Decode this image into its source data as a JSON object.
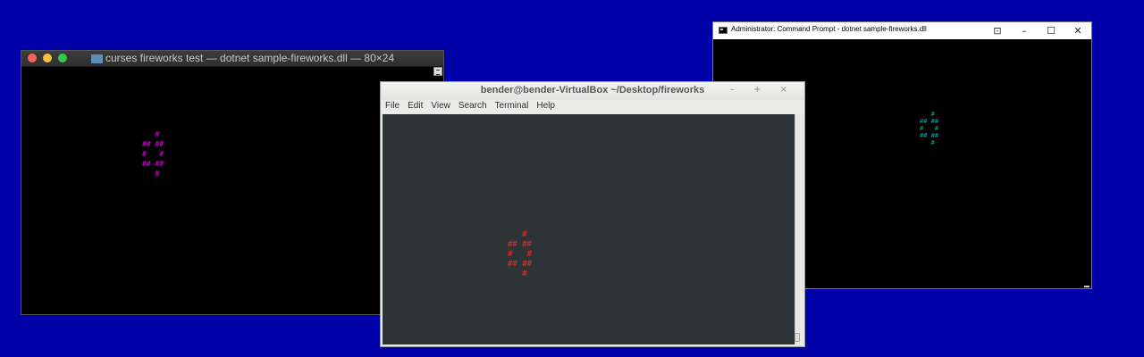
{
  "mac_terminal": {
    "title": "curses fireworks test — dotnet sample-fireworks.dll — 80×24",
    "firework": "   #\n## ##\n#   #\n## ##\n   #",
    "firework_color": "#c000c0"
  },
  "linux_terminal": {
    "title": "bender@bender-VirtualBox ~/Desktop/fireworks",
    "window_buttons": "– + ×",
    "menu": [
      "File",
      "Edit",
      "View",
      "Search",
      "Terminal",
      "Help"
    ],
    "firework": "   #\n## ##\n#   #\n## ##\n   #",
    "firework_color": "#d02828"
  },
  "windows_cmd": {
    "title": "Administrator: Command Prompt - dotnet  sample-fireworks.dll",
    "buttons": {
      "extra": "⊡",
      "minimize": "–",
      "maximize": "☐",
      "close": "✕"
    },
    "firework": "   #\n## ##\n#   #\n## ##\n   #",
    "firework_color": "#20a0a0"
  },
  "background_color": "#0000a8"
}
